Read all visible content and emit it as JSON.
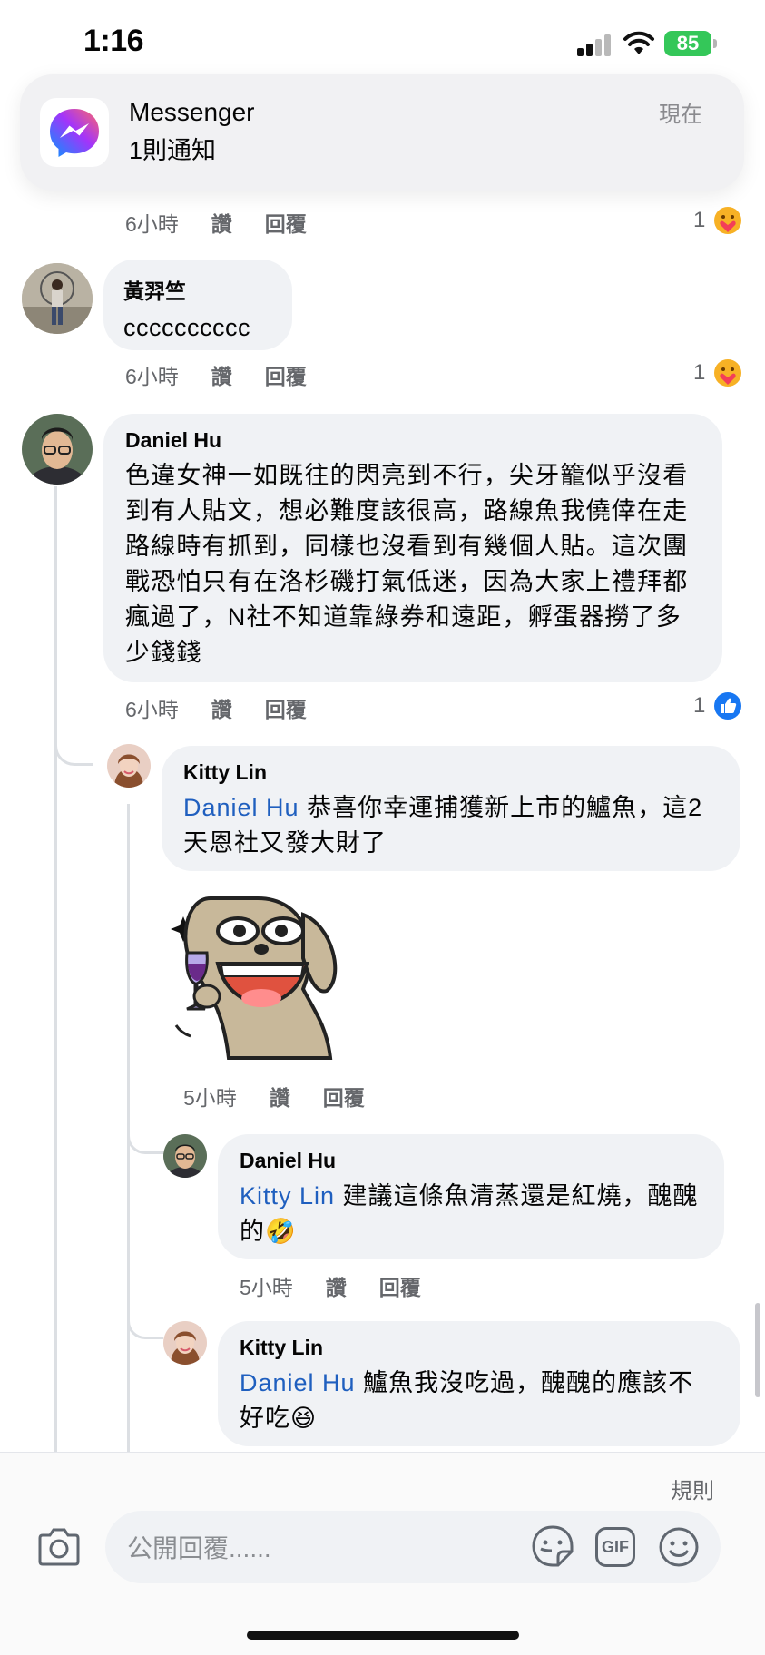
{
  "status_bar": {
    "time": "1:16",
    "battery": "85"
  },
  "notification": {
    "app_name": "Messenger",
    "body": "1則通知",
    "time": "現在"
  },
  "comments": [
    {
      "time": "6小時",
      "like_label": "讚",
      "reply_label": "回覆",
      "reaction_count": "1",
      "reaction": "care"
    },
    {
      "author": "黃羿竺",
      "text": "cccccccccc",
      "time": "6小時",
      "like_label": "讚",
      "reply_label": "回覆",
      "reaction_count": "1",
      "reaction": "care"
    },
    {
      "author": "Daniel Hu",
      "text": "色違女神一如既往的閃亮到不行，尖牙籠似乎沒看到有人貼文，想必難度該很高，路線魚我僥倖在走路線時有抓到，同樣也沒看到有幾個人貼。這次團戰恐怕只有在洛杉磯打氣低迷，因為大家上禮拜都瘋過了，N社不知道靠綠券和遠距，孵蛋器撈了多少錢錢",
      "time": "6小時",
      "like_label": "讚",
      "reply_label": "回覆",
      "reaction_count": "1",
      "reaction": "like"
    },
    {
      "author": "Kitty Lin",
      "mention": "Daniel Hu",
      "text": " 恭喜你幸運捕獲新上市的鱸魚，這2天恩社又發大財了",
      "sticker": "dog-wine-sticker",
      "time": "5小時",
      "like_label": "讚",
      "reply_label": "回覆"
    },
    {
      "author": "Daniel Hu",
      "mention": "Kitty Lin",
      "text": " 建議這條魚清蒸還是紅燒，醜醜的",
      "emoji": "🤣",
      "time": "5小時",
      "like_label": "讚",
      "reply_label": "回覆"
    },
    {
      "author": "Kitty Lin",
      "mention": "Daniel Hu",
      "text": " 鱸魚我沒吃過，醜醜的應該不好吃",
      "emoji": "😆"
    }
  ],
  "composer": {
    "rules": "規則",
    "placeholder": "公開回覆......",
    "gif_label": "GIF"
  },
  "colors": {
    "mention": "#1f5fbf",
    "bubble": "#f0f2f5",
    "like_blue": "#1877f2",
    "battery": "#34c759"
  }
}
